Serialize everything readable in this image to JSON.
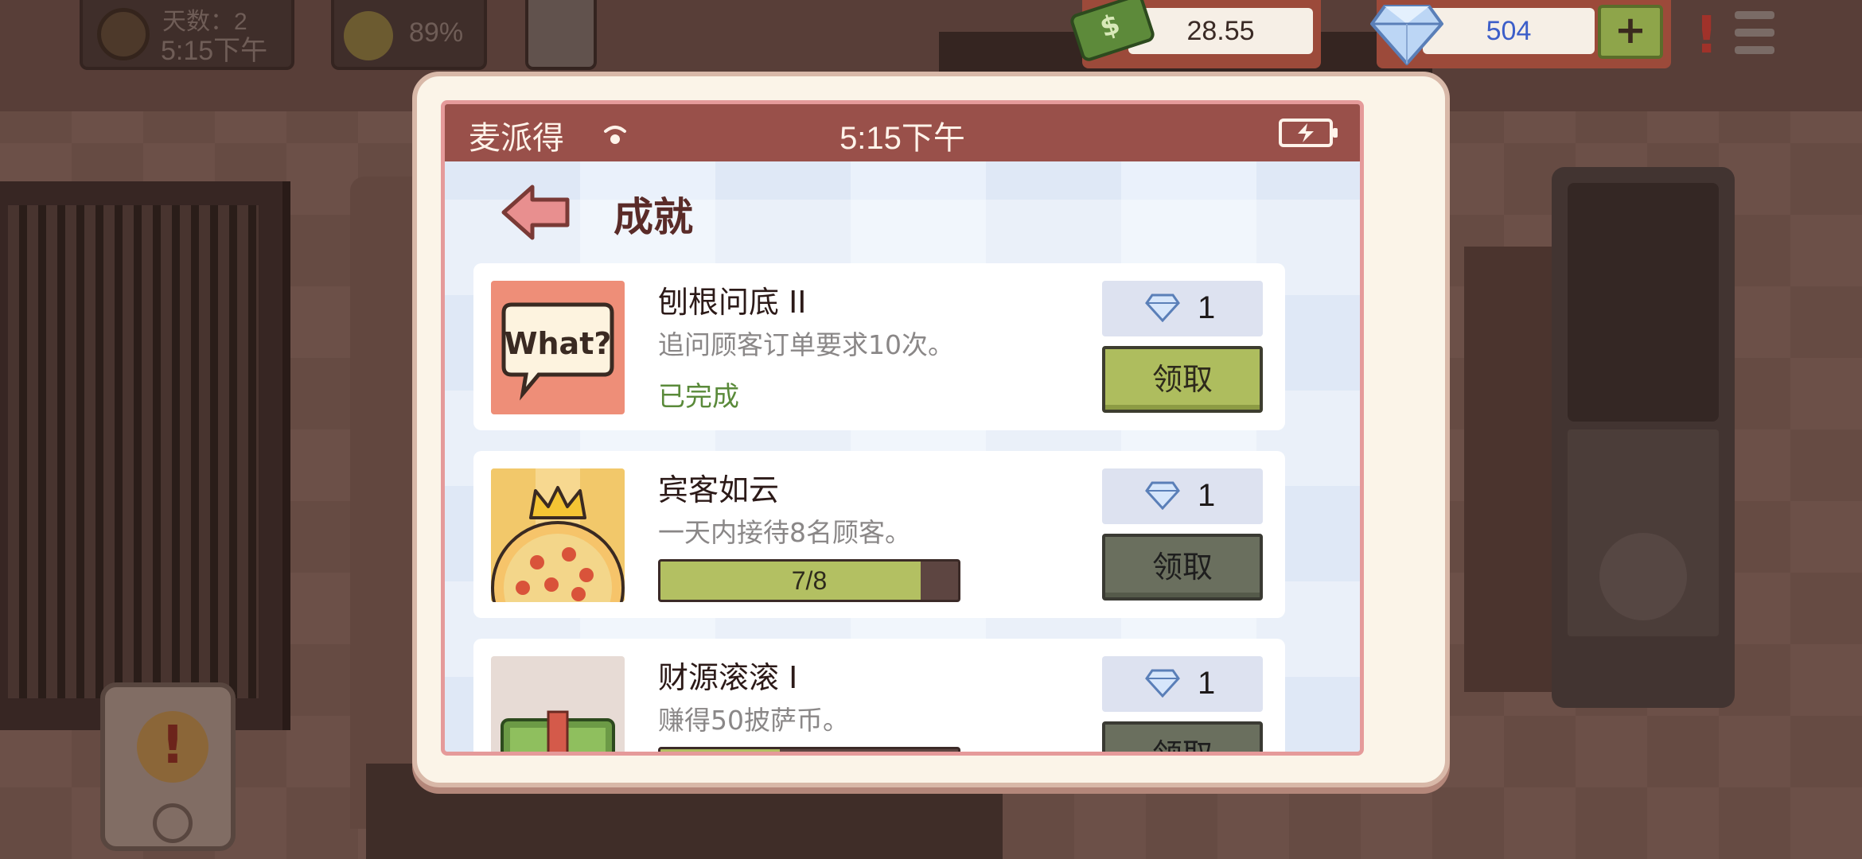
{
  "hud": {
    "day_label": "天数：2",
    "time": "5:15下午",
    "happiness": "89%",
    "money": "28.55",
    "gems": "504",
    "add_label": "+"
  },
  "phone": {
    "carrier": "麦派得",
    "clock": "5:15下午",
    "page_title": "成就"
  },
  "achievements": [
    {
      "title": "刨根问底 II",
      "description": "追问顾客订单要求10次。",
      "status": "已完成",
      "reward": "1",
      "claim_label": "领取",
      "claimable": true,
      "thumb_text": "What?"
    },
    {
      "title": "宾客如云",
      "description": "一天内接待8名顾客。",
      "progress_label": "7/8",
      "progress_fraction": 0.875,
      "reward": "1",
      "claim_label": "领取",
      "claimable": false
    },
    {
      "title": "财源滚滚 I",
      "description": "赚得50披萨币。",
      "progress_fraction": 0.4,
      "reward": "1",
      "claim_label": "领取",
      "claimable": false
    }
  ],
  "colors": {
    "status_bar": "#99504a",
    "claim_active": "#aebd5e",
    "claim_inactive": "#6a6f5e",
    "progress_fill": "#b3c062",
    "gem_blue": "#3c5ec9"
  },
  "icons": [
    "sun-icon",
    "smile-icon",
    "cash-icon",
    "gem-icon",
    "menu-icon",
    "wifi-icon",
    "battery-icon",
    "back-arrow-icon",
    "speech-bubble-icon",
    "pizza-crown-icon",
    "money-stack-icon"
  ]
}
